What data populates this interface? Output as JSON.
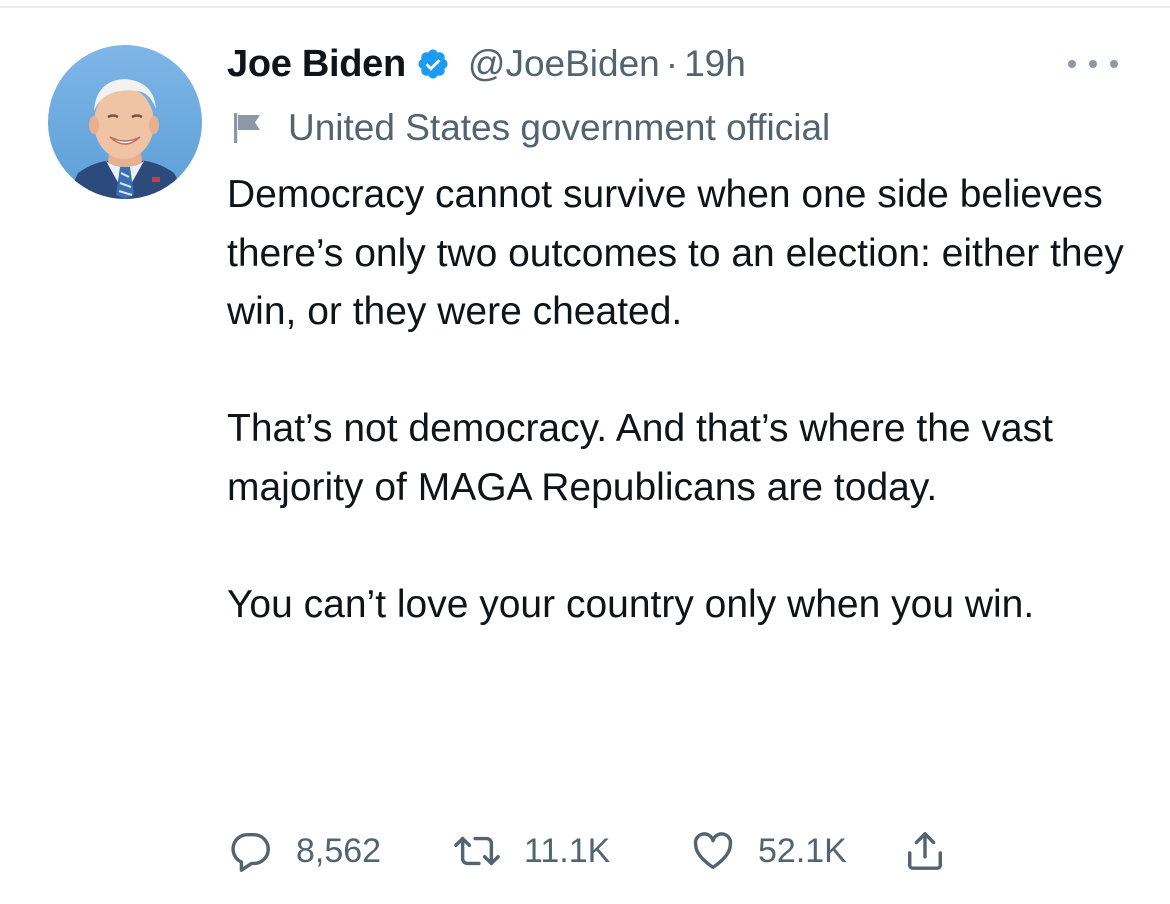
{
  "tweet": {
    "author": {
      "name": "Joe Biden",
      "verified": true,
      "handle": "@JoeBiden",
      "separator": "·",
      "timestamp": "19h"
    },
    "label": {
      "icon": "flag-icon",
      "text": "United States government official"
    },
    "paragraphs": [
      "Democracy cannot survive when one side believes there’s only two outcomes to an election: either they win, or they were cheated.",
      "That’s not democracy. And that’s where the vast majority of MAGA Republicans are today.",
      "You can’t love your country only when you win."
    ],
    "actions": {
      "replies": "8,562",
      "retweets": "11.1K",
      "likes": "52.1K"
    }
  },
  "colors": {
    "text": "#0f1419",
    "secondary": "#536471",
    "verified": "#1d9bf0",
    "divider": "#e6ecf0"
  }
}
